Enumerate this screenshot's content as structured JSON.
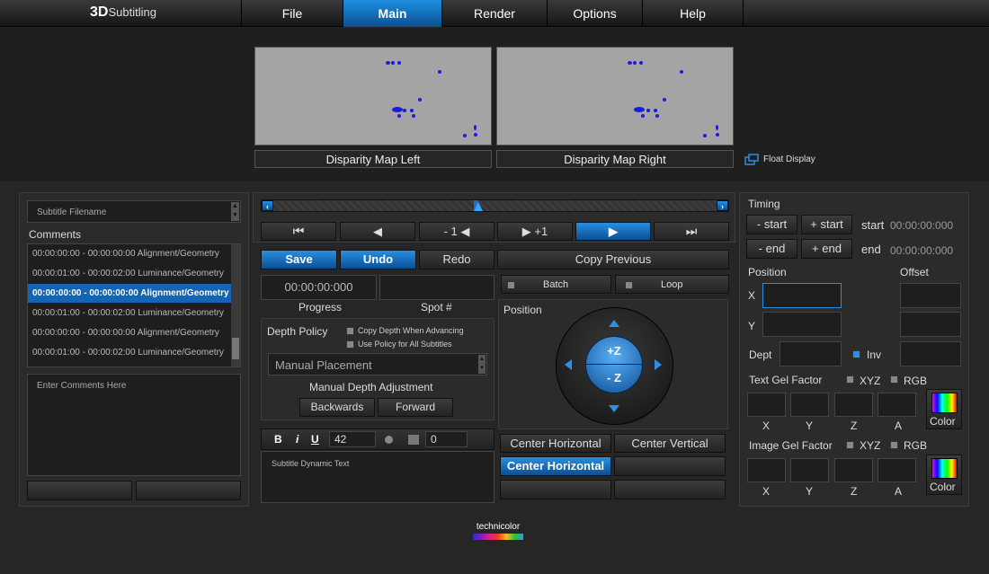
{
  "app": {
    "logo_main": "3D",
    "logo_sub": "Subtitling"
  },
  "menu": [
    "File",
    "Main",
    "Render",
    "Options",
    "Help"
  ],
  "preview": {
    "left_label": "Disparity Map Left",
    "right_label": "Disparity Map Right",
    "float_display": "Float Display"
  },
  "subtitle_file": {
    "placeholder": "Subtitle Filename"
  },
  "comments": {
    "title": "Comments",
    "rows": [
      "00:00:00:00 - 00:00:00:00 Alignment/Geometry",
      "00:00:01:00 - 00:00:02:00 Luminance/Geometry",
      "00:00:00:00 - 00:00:00:00 Alignment/Geometry",
      "00:00:01:00 - 00:00:02:00 Luminance/Geometry",
      "00:00:00:00 - 00:00:00:00 Alignment/Geometry",
      "00:00:01:00 - 00:00:02:00 Luminance/Geometry"
    ],
    "selected_index": 2,
    "input_placeholder": "Enter Comments Here"
  },
  "transport": {
    "minus_one": "- 1",
    "plus_one": "+1",
    "scrub_position": 0.5
  },
  "edit": {
    "save": "Save",
    "undo": "Undo",
    "redo": "Redo",
    "copy_previous": "Copy Previous",
    "timecode": "00:00:00:000",
    "progress": "Progress",
    "spot": "Spot #",
    "batch": "Batch",
    "loop": "Loop"
  },
  "depth": {
    "title": "Depth Policy",
    "copy_depth": "Copy Depth When Advancing",
    "use_policy": "Use Policy for All Subtitles",
    "placement": "Manual Placement",
    "manual_adjust": "Manual Depth Adjustment",
    "backwards": "Backwards",
    "forward": "Forward"
  },
  "text_editor": {
    "bold": "B",
    "italic": "i",
    "underline": "U",
    "size": "42",
    "value": "0",
    "body": "Subtitle Dynamic Text"
  },
  "position_panel": {
    "title": "Position",
    "plus_z": "+Z",
    "minus_z": "- Z",
    "center_h": "Center Horizontal",
    "center_v": "Center Vertical",
    "center_h_active": "Center Horizontal"
  },
  "timing": {
    "title": "Timing",
    "minus_start": "- start",
    "plus_start": "+ start",
    "start_label": "start",
    "start_value": "00:00:00:000",
    "minus_end": "- end",
    "plus_end": "+ end",
    "end_label": "end",
    "end_value": "00:00:00:000"
  },
  "position_fields": {
    "title": "Position",
    "offset": "Offset",
    "x": "X",
    "y": "Y",
    "dept": "Dept",
    "inv": "Inv"
  },
  "text_gel": {
    "title": "Text Gel Factor",
    "xyz": "XYZ",
    "rgb": "RGB",
    "x": "X",
    "y": "Y",
    "z": "Z",
    "a": "A",
    "color": "Color"
  },
  "image_gel": {
    "title": "Image Gel Factor",
    "xyz": "XYZ",
    "rgb": "RGB",
    "x": "X",
    "y": "Y",
    "z": "Z",
    "a": "A",
    "color": "Color"
  },
  "footer": {
    "brand": "technicolor"
  }
}
